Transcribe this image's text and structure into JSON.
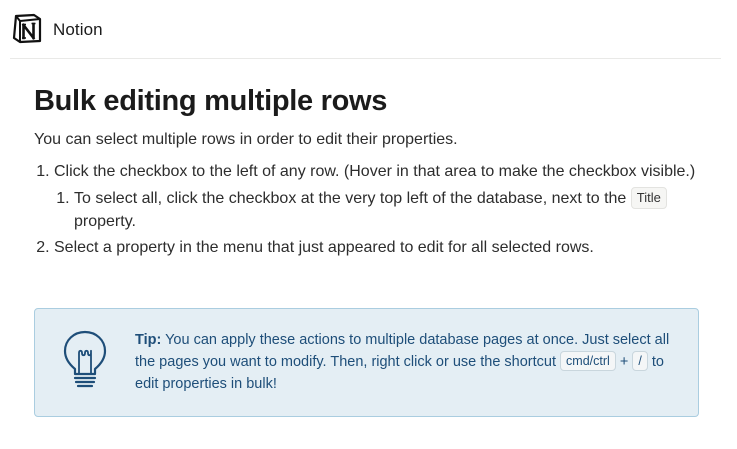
{
  "header": {
    "brand": "Notion",
    "logo_icon": "notion-logo-icon"
  },
  "article": {
    "title": "Bulk editing multiple rows",
    "intro": "You can select multiple rows in order to edit their properties.",
    "steps": [
      {
        "text": "Click the checkbox to the left of any row. (Hover in that area to make the checkbox visible.)",
        "substeps": [
          {
            "before": "To select all, click the checkbox at the very top left of the database, next to the",
            "code": "Title",
            "after": "property."
          }
        ]
      },
      {
        "text": "Select a property in the menu that just appeared to edit for all selected rows."
      }
    ]
  },
  "callout": {
    "icon": "lightbulb-icon",
    "tip_label": "Tip:",
    "text_before": "You can apply these actions to multiple database pages at once. Just select all the pages you want to modify. Then, right click or use the shortcut",
    "key1": "cmd/ctrl",
    "plus": "+",
    "key2": "/",
    "text_after": "to edit properties in bulk!"
  },
  "colors": {
    "callout_bg": "#e4eef4",
    "callout_border": "#aacde0",
    "callout_text": "#1e4e79"
  }
}
